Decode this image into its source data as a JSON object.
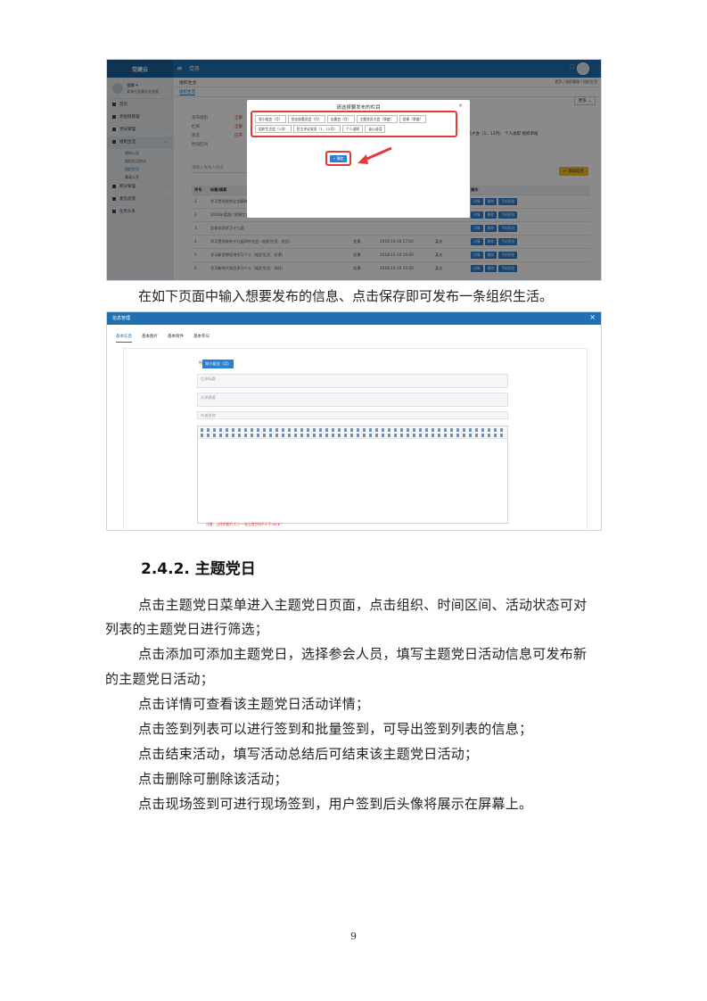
{
  "shot1": {
    "logo": "党建云",
    "top_tab": "党务",
    "user": {
      "name": "张群 ▾",
      "org": "某单位党委机关党委"
    },
    "nav": [
      {
        "label": "首页",
        "chev": ""
      },
      {
        "label": "党组织管理",
        "chev": "›"
      },
      {
        "label": "党员管理",
        "chev": "›"
      },
      {
        "label": "组织生活",
        "chev": "⌄"
      }
    ],
    "sub_nav": [
      "通知公告",
      "组织生活统计",
      "组织生活",
      "廉政公开"
    ],
    "nav_after": [
      {
        "label": "积分管理",
        "chev": "›"
      },
      {
        "label": "意见反馈",
        "chev": "›"
      },
      {
        "label": "任务头条",
        "chev": "›"
      }
    ],
    "crumb_title": "组织生活",
    "crumb_right": "首页 / 组织管理 / 组织生活",
    "tab": "组织生活",
    "filters": [
      {
        "label": "发布组织",
        "value": "全部"
      },
      {
        "label": "栏目",
        "value": "全部"
      },
      {
        "label": "状态",
        "value": "已开"
      },
      {
        "label": "时间区间",
        "value": ""
      }
    ],
    "more_button": "更多 ⌄",
    "right_opts": "党员大会（1、12月）   个人述职   组织审核",
    "search_placeholder": "请输入发布人姓名",
    "add_button": "+ 添加信息",
    "table_headers": [
      "序号",
      "标题/摘要",
      "",
      "",
      "",
      "操作"
    ],
    "rows": [
      [
        "1",
        "学习贯彻党的全会精神",
        "",
        "",
        "",
        ""
      ],
      [
        "2",
        "2018年度部门党建工作",
        "",
        "",
        "",
        ""
      ],
      [
        "3",
        "全体党员学习十九届",
        "",
        "",
        "",
        ""
      ],
      [
        "4",
        "学习贯彻党的十九届四中全会（组织生活、党员）",
        "党课",
        "2018-10-10 17:00",
        "某支",
        ""
      ],
      [
        "5",
        "学习新思想宣讲学习个人（组织生活、党课）",
        "党课",
        "2018-10-10 16:00",
        "某支",
        ""
      ],
      [
        "6",
        "学习新时代党员学习个人（组织生活、学时）",
        "党课",
        "2018-10-10 15:00",
        "某支",
        ""
      ]
    ],
    "row_buttons": [
      "详情",
      "删除",
      "手机预览"
    ],
    "modal": {
      "title": "请选择要发布的栏目",
      "close": "×",
      "options": [
        "党小组会（月）",
        "党支部委员会（月）",
        "支委会（月）",
        "主题党员大会（季度）",
        "党课（季度）",
        "组织生活会（1次）",
        "民主评议党员（1、12月）",
        "个人述职",
        "谈心谈话"
      ],
      "confirm": "✓ 确定"
    }
  },
  "caption": "在如下页面中输入想要发布的信息、点击保存即可发布一条组织生活。",
  "shot2": {
    "title": "信息管理",
    "close": "×",
    "tabs": [
      "基本信息",
      "基本图片",
      "基本附件",
      "基本参与"
    ],
    "fields": {
      "category_label": "所属栏目 *",
      "category_value": "党小组会（月）",
      "title_label": "信息标题 *",
      "title_placeholder": "信息标题",
      "summary_label": "文章摘要",
      "summary_placeholder": "文章摘要",
      "author_label": "作者 *",
      "author_placeholder": "作者名称",
      "content_label": "文章内容"
    },
    "hint": "注意：上传的图片大小 一张占用空间不少于300K！"
  },
  "heading": "2.4.2.  主题党日",
  "paragraphs": [
    "点击主题党日菜单进入主题党日页面，点击组织、时间区间、活动状态可对",
    "列表的主题党日进行筛选；",
    "点击添加可添加主题党日，选择参会人员，填写主题党日活动信息可发布新",
    "的主题党日活动；",
    "点击详情可查看该主题党日活动详情；",
    "点击签到列表可以进行签到和批量签到，可导出签到列表的信息；",
    "点击结束活动，填写活动总结后可结束该主题党日活动；",
    "点击删除可删除该活动；",
    "点击现场签到可进行现场签到，用户签到后头像将展示在屏幕上。"
  ],
  "page_number": "9"
}
